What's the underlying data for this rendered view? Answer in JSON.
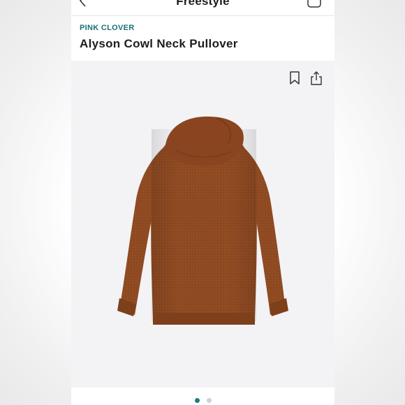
{
  "nav": {
    "title": "Freestyle",
    "back_icon": "chevron-left-icon",
    "bag_icon": "bag-icon"
  },
  "product": {
    "brand": "PINK CLOVER",
    "name": "Alyson Cowl Neck Pullover",
    "color": "#8f4a22",
    "image_icon": "sweater-image"
  },
  "actions": {
    "bookmark_icon": "bookmark-icon",
    "share_icon": "share-icon"
  },
  "gallery": {
    "total_pages": 2,
    "active_page": 1
  },
  "colors": {
    "brand_teal": "#1b6e74",
    "active_dot": "#1b7d86",
    "inactive_dot": "#d0d0d0",
    "image_bg": "#f3f3f5"
  }
}
